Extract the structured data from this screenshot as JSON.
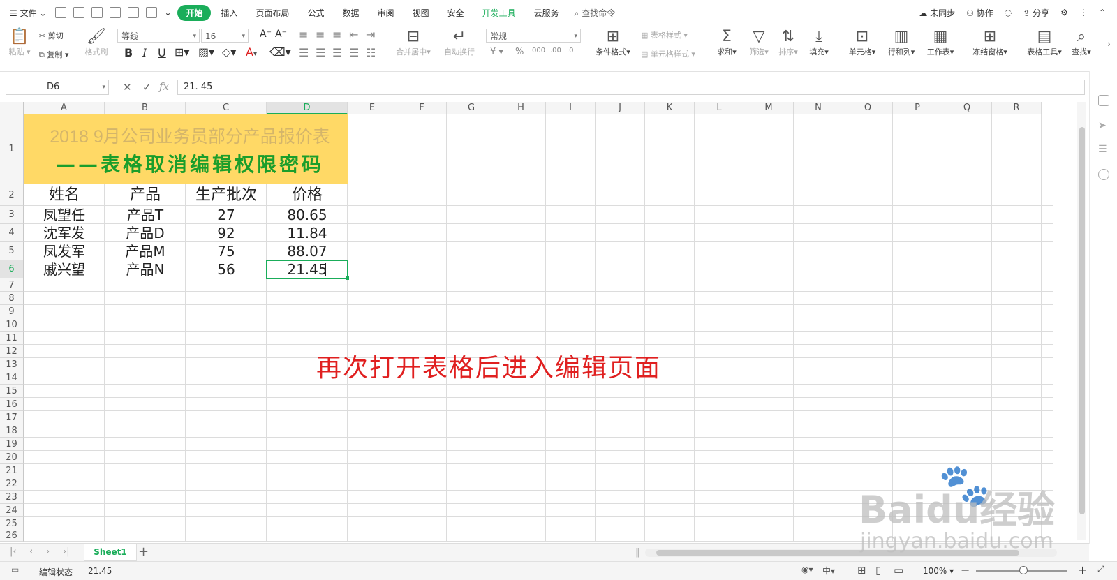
{
  "menu": {
    "file": "文件",
    "tabs": [
      "开始",
      "插入",
      "页面布局",
      "公式",
      "数据",
      "审阅",
      "视图",
      "安全",
      "开发工具",
      "云服务"
    ],
    "search": "查找命令",
    "right": [
      "未同步",
      "协作",
      "分享"
    ]
  },
  "ribbon": {
    "paste": "粘贴",
    "cut": "剪切",
    "copy": "复制",
    "format_painter": "格式刷",
    "font_name": "等线",
    "font_size": "16",
    "merge": "合并居中",
    "wrap": "自动换行",
    "number_format": "常规",
    "cond_format": "条件格式",
    "table_style": "表格样式",
    "cell_style": "单元格样式",
    "sum": "求和",
    "filter": "筛选",
    "sort": "排序",
    "fill": "填充",
    "cells": "单元格",
    "rows_cols": "行和列",
    "worksheet": "工作表",
    "freeze": "冻结窗格",
    "table_tools": "表格工具",
    "find": "查找"
  },
  "formula": {
    "name_box": "D6",
    "fx_value": "21. 45"
  },
  "sheet": {
    "columns": [
      "A",
      "B",
      "C",
      "D",
      "E",
      "F",
      "G",
      "H",
      "I",
      "J",
      "K",
      "L",
      "M",
      "N",
      "O",
      "P",
      "Q",
      "R"
    ],
    "rows": [
      "1",
      "2",
      "3",
      "4",
      "5",
      "6",
      "7",
      "8",
      "9",
      "10",
      "11",
      "12",
      "13",
      "14",
      "15",
      "16",
      "17",
      "18",
      "19",
      "20",
      "21",
      "22",
      "23",
      "24",
      "25",
      "26"
    ],
    "title_line1": "2018 9月公司业务员部分产品报价表",
    "title_line2": "——表格取消编辑权限密码",
    "headers": [
      "姓名",
      "产品",
      "生产批次",
      "价格"
    ],
    "data": [
      [
        "凤望任",
        "产品T",
        "27",
        "80.65"
      ],
      [
        "沈军发",
        "产品D",
        "92",
        "11.84"
      ],
      [
        "凤发军",
        "产品M",
        "75",
        "88.07"
      ],
      [
        "戚兴望",
        "产品N",
        "56",
        "21.45"
      ]
    ],
    "annotation": "再次打开表格后进入编辑页面"
  },
  "sheet_tab": "Sheet1",
  "status": {
    "mode": "编辑状态",
    "value": "21.45",
    "zoom": "100%"
  },
  "watermark": {
    "brand": "Baidu经验",
    "url": "jingyan.baidu.com"
  },
  "colors": {
    "accent": "#1aad5a",
    "title_fill": "#ffd966",
    "title2": "#1b9e2b",
    "annotation": "#e02020"
  }
}
